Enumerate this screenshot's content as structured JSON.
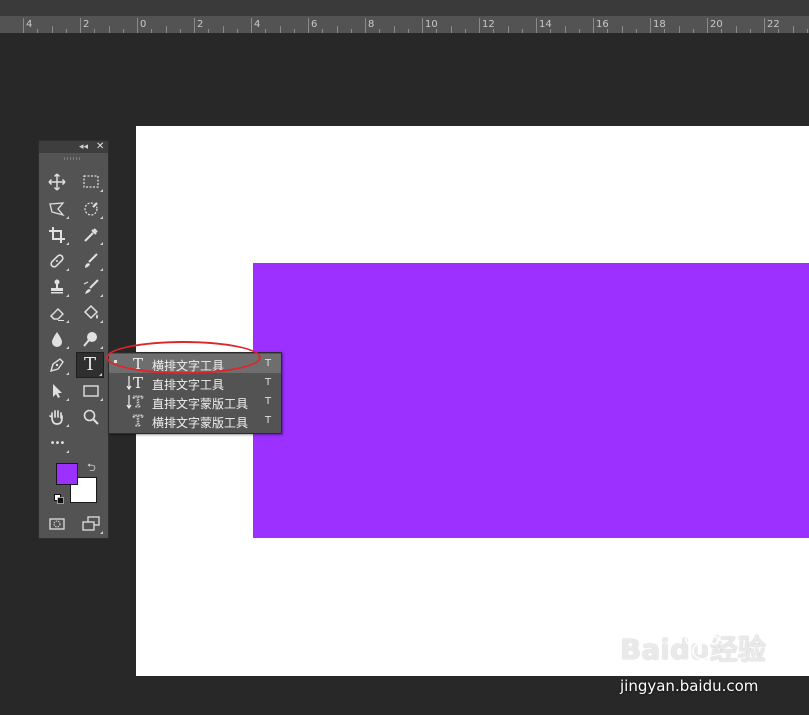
{
  "ruler": {
    "labels": [
      "4",
      "2",
      "0",
      "2",
      "4",
      "6",
      "8",
      "10",
      "12",
      "14",
      "16",
      "18",
      "20",
      "22"
    ]
  },
  "canvas": {
    "background": "#ffffff",
    "shape_color": "#9b30ff"
  },
  "toolbox": {
    "collapse_glyph": "◂◂",
    "close_glyph": "✕",
    "tools": [
      {
        "name": "move-tool",
        "icon": "move-icon"
      },
      {
        "name": "marquee-tool",
        "icon": "rect-marquee-icon"
      },
      {
        "name": "lasso-tool",
        "icon": "polygon-lasso-icon"
      },
      {
        "name": "quick-select-tool",
        "icon": "quick-select-icon"
      },
      {
        "name": "crop-tool",
        "icon": "crop-icon"
      },
      {
        "name": "eyedropper-tool",
        "icon": "eyedropper-icon"
      },
      {
        "name": "healing-tool",
        "icon": "healing-brush-icon"
      },
      {
        "name": "brush-tool",
        "icon": "brush-icon"
      },
      {
        "name": "stamp-tool",
        "icon": "clone-stamp-icon"
      },
      {
        "name": "history-brush-tool",
        "icon": "history-brush-icon"
      },
      {
        "name": "eraser-tool",
        "icon": "eraser-icon"
      },
      {
        "name": "paint-bucket-tool",
        "icon": "paint-bucket-icon"
      },
      {
        "name": "blur-tool",
        "icon": "blur-drop-icon"
      },
      {
        "name": "dodge-tool",
        "icon": "dodge-icon"
      },
      {
        "name": "pen-tool",
        "icon": "pen-icon"
      },
      {
        "name": "type-tool",
        "icon": "type-icon"
      },
      {
        "name": "path-select-tool",
        "icon": "path-select-icon"
      },
      {
        "name": "shape-tool",
        "icon": "rectangle-icon"
      },
      {
        "name": "hand-tool",
        "icon": "hand-icon"
      },
      {
        "name": "zoom-tool",
        "icon": "zoom-icon"
      },
      {
        "name": "more-tools",
        "icon": "ellipsis-icon"
      }
    ],
    "type_glyph": "T",
    "more_glyph": "•••",
    "foreground_color": "#9b30ff",
    "background_color": "#ffffff",
    "swap_glyph": "⮌"
  },
  "flyout": {
    "items": [
      {
        "label": "横排文字工具",
        "shortcut": "T",
        "icon": "horizontal-type-icon",
        "selected": true
      },
      {
        "label": "直排文字工具",
        "shortcut": "T",
        "icon": "vertical-type-icon",
        "selected": false
      },
      {
        "label": "直排文字蒙版工具",
        "shortcut": "T",
        "icon": "vertical-type-mask-icon",
        "selected": false
      },
      {
        "label": "横排文字蒙版工具",
        "shortcut": "T",
        "icon": "horizontal-type-mask-icon",
        "selected": false
      }
    ],
    "highlight_color": "#e0242c"
  },
  "watermark": {
    "logo": "Baidu经验",
    "url": "jingyan.baidu.com"
  }
}
